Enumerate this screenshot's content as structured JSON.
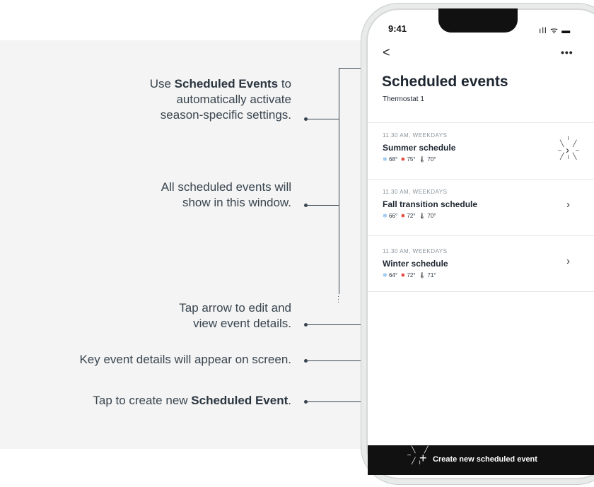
{
  "callouts": [
    {
      "pre": "Use ",
      "bold": "Scheduled Events",
      "post": " to",
      "line2": "automatically activate",
      "line3": "season-specific settings."
    },
    {
      "line1": "All scheduled events will",
      "line2": "show in this window."
    },
    {
      "line1": "Tap arrow to edit and",
      "line2": "view event details."
    },
    {
      "line1": "Key event details will appear on screen."
    },
    {
      "pre": "Tap to create new ",
      "bold": "Scheduled Event",
      "post": "."
    }
  ],
  "phone": {
    "time": "9:41",
    "status_icons": "ıll ᯤ ▬",
    "back_icon": "<",
    "more_icon": "•••",
    "title": "Scheduled events",
    "subtitle": "Thermostat 1",
    "events": [
      {
        "time": "11.30 AM, WEEKDAYS",
        "name": "Summer schedule",
        "cool": "68°",
        "heat": "75°",
        "set": "70°"
      },
      {
        "time": "11.30 AM, WEEKDAYS",
        "name": "Fall transition schedule",
        "cool": "66°",
        "heat": "72°",
        "set": "70°"
      },
      {
        "time": "11.30 AM, WEEKDAYS",
        "name": "Winter schedule",
        "cool": "64°",
        "heat": "72°",
        "set": "71°"
      }
    ],
    "create_label": "Create new scheduled event",
    "icons": {
      "cool": "snowflake-icon",
      "heat": "sun-icon",
      "set": "thermometer-icon",
      "arrow": "chevron-right-icon",
      "add": "plus-icon"
    }
  },
  "colors": {
    "panel": "#f3f4f3",
    "text": "#3a4550",
    "cool": "#5aa3e6",
    "heat": "#e2483c",
    "bar": "#111111"
  }
}
